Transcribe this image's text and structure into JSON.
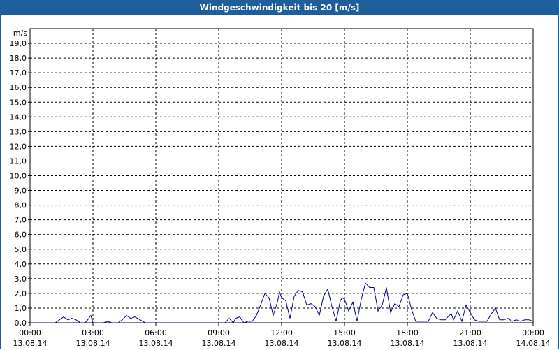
{
  "window": {
    "title": "Windgeschwindigkeit bis 20 [m/s]"
  },
  "colors": {
    "title_bar": "#1f5f99",
    "line": "#00008b",
    "grid": "#000000"
  },
  "chart_data": {
    "type": "line",
    "title": "Windgeschwindigkeit bis 20 [m/s]",
    "ylabel": "m/s",
    "ylim": [
      0,
      20
    ],
    "xlim_hours": [
      0,
      24
    ],
    "grid": true,
    "grid_style": "dashed",
    "y_ticks": [
      "0,0",
      "1,0",
      "2,0",
      "3,0",
      "4,0",
      "5,0",
      "6,0",
      "7,0",
      "8,0",
      "9,0",
      "10,0",
      "11,0",
      "12,0",
      "13,0",
      "14,0",
      "15,0",
      "16,0",
      "17,0",
      "18,0",
      "19,0"
    ],
    "x_ticks": [
      {
        "time": "00:00",
        "date": "13.08.14"
      },
      {
        "time": "03:00",
        "date": "13.08.14"
      },
      {
        "time": "06:00",
        "date": "13.08.14"
      },
      {
        "time": "09:00",
        "date": "13.08.14"
      },
      {
        "time": "12:00",
        "date": "13.08.14"
      },
      {
        "time": "15:00",
        "date": "13.08.14"
      },
      {
        "time": "18:00",
        "date": "13.08.14"
      },
      {
        "time": "21:00",
        "date": "13.08.14"
      },
      {
        "time": "00:00",
        "date": "14.08.14"
      }
    ],
    "series": [
      {
        "x_hours": [
          0,
          1.2,
          1.4,
          1.6,
          1.8,
          2.0,
          2.2,
          2.4,
          2.6,
          2.7,
          2.9,
          3.0,
          3.1,
          3.2,
          3.3,
          3.5,
          3.7,
          3.9,
          4.0,
          4.2,
          4.4,
          4.6,
          4.8,
          5.0,
          5.5,
          6.0,
          6.5,
          7.0,
          7.5,
          8.0,
          8.5,
          9.0,
          9.3,
          9.5,
          9.7,
          9.8,
          10.0,
          10.2,
          10.4,
          10.6,
          10.8,
          11.0,
          11.2,
          11.4,
          11.6,
          11.8,
          11.9,
          12.0,
          12.2,
          12.4,
          12.6,
          12.8,
          13.0,
          13.2,
          13.4,
          13.6,
          13.8,
          14.0,
          14.2,
          14.4,
          14.6,
          14.8,
          14.9,
          15.0,
          15.2,
          15.4,
          15.6,
          15.8,
          16.0,
          16.2,
          16.4,
          16.6,
          16.8,
          17.0,
          17.2,
          17.4,
          17.6,
          17.8,
          18.0,
          18.2,
          18.4,
          18.6,
          18.8,
          19.0,
          19.2,
          19.4,
          19.6,
          19.8,
          20.0,
          20.1,
          20.2,
          20.4,
          20.6,
          20.8,
          21.0,
          21.2,
          21.4,
          21.6,
          21.8,
          22.0,
          22.2,
          22.4,
          22.6,
          22.8,
          23.0,
          23.2,
          23.4,
          23.6,
          23.8,
          24.0
        ],
        "values": [
          0,
          0,
          0.2,
          0.4,
          0.2,
          0.3,
          0.2,
          0.0,
          0.0,
          0.1,
          0.5,
          0.0,
          0.0,
          0.0,
          0.0,
          0.0,
          0.1,
          0.0,
          0.0,
          0.0,
          0.2,
          0.5,
          0.3,
          0.4,
          0.0,
          0.0,
          0.0,
          0.0,
          0.0,
          0.0,
          0.0,
          0.0,
          0.0,
          0.3,
          0.0,
          0.3,
          0.4,
          0.0,
          0.1,
          0.1,
          0.5,
          1.2,
          2.0,
          1.7,
          0.5,
          1.4,
          2.1,
          1.7,
          1.5,
          0.3,
          1.8,
          2.2,
          2.1,
          1.2,
          1.3,
          1.1,
          0.5,
          1.8,
          2.3,
          1.1,
          0.1,
          1.5,
          1.7,
          1.6,
          0.8,
          1.4,
          0.1,
          1.6,
          2.7,
          2.4,
          2.4,
          0.8,
          1.2,
          2.4,
          0.7,
          1.3,
          1.1,
          1.9,
          2.0,
          0.9,
          0.1,
          0.1,
          0.1,
          0.1,
          0.7,
          0.3,
          0.2,
          0.2,
          0.5,
          0.6,
          0.2,
          0.8,
          0.1,
          1.2,
          0.7,
          0.2,
          0.1,
          0.1,
          0.1,
          0.6,
          1.0,
          0.2,
          0.2,
          0.3,
          0.1,
          0.2,
          0.1,
          0.2,
          0.2,
          0.1
        ]
      }
    ]
  }
}
